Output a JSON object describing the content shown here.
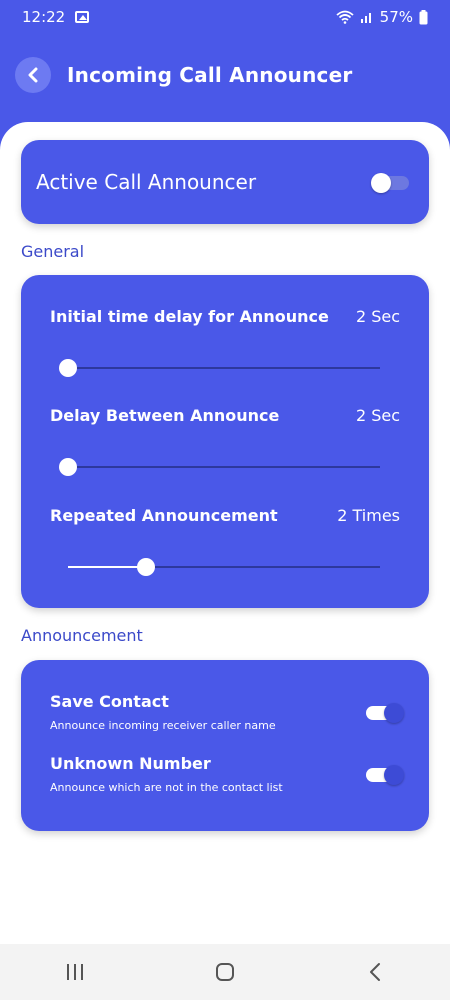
{
  "status_bar": {
    "time": "12:22",
    "battery": "57%"
  },
  "app_bar": {
    "title": "Incoming Call Announcer"
  },
  "active_card": {
    "label": "Active Call Announcer",
    "enabled": false
  },
  "sections": {
    "general": "General",
    "announcement": "Announcement"
  },
  "general": {
    "sliders": [
      {
        "title": "Initial time delay for Announce",
        "value": "2 Sec",
        "level": 0.0
      },
      {
        "title": "Delay Between Announce",
        "value": "2 Sec",
        "level": 0.0
      },
      {
        "title": "Repeated Announcement",
        "value": "2 Times",
        "level": 0.25
      }
    ]
  },
  "announcement": {
    "toggles": [
      {
        "title": "Save Contact",
        "desc": "Announce incoming receiver caller name",
        "enabled": true
      },
      {
        "title": "Unknown Number",
        "desc": "Announce which are not in the contact list",
        "enabled": true
      }
    ]
  },
  "colors": {
    "primary": "#4a58e8",
    "section_text": "#3b49c9",
    "nav_bg": "#f3f3f3"
  },
  "icons": {
    "back": "chevron-left-icon",
    "nav": [
      "recent-apps-icon",
      "home-icon",
      "back-icon"
    ]
  }
}
